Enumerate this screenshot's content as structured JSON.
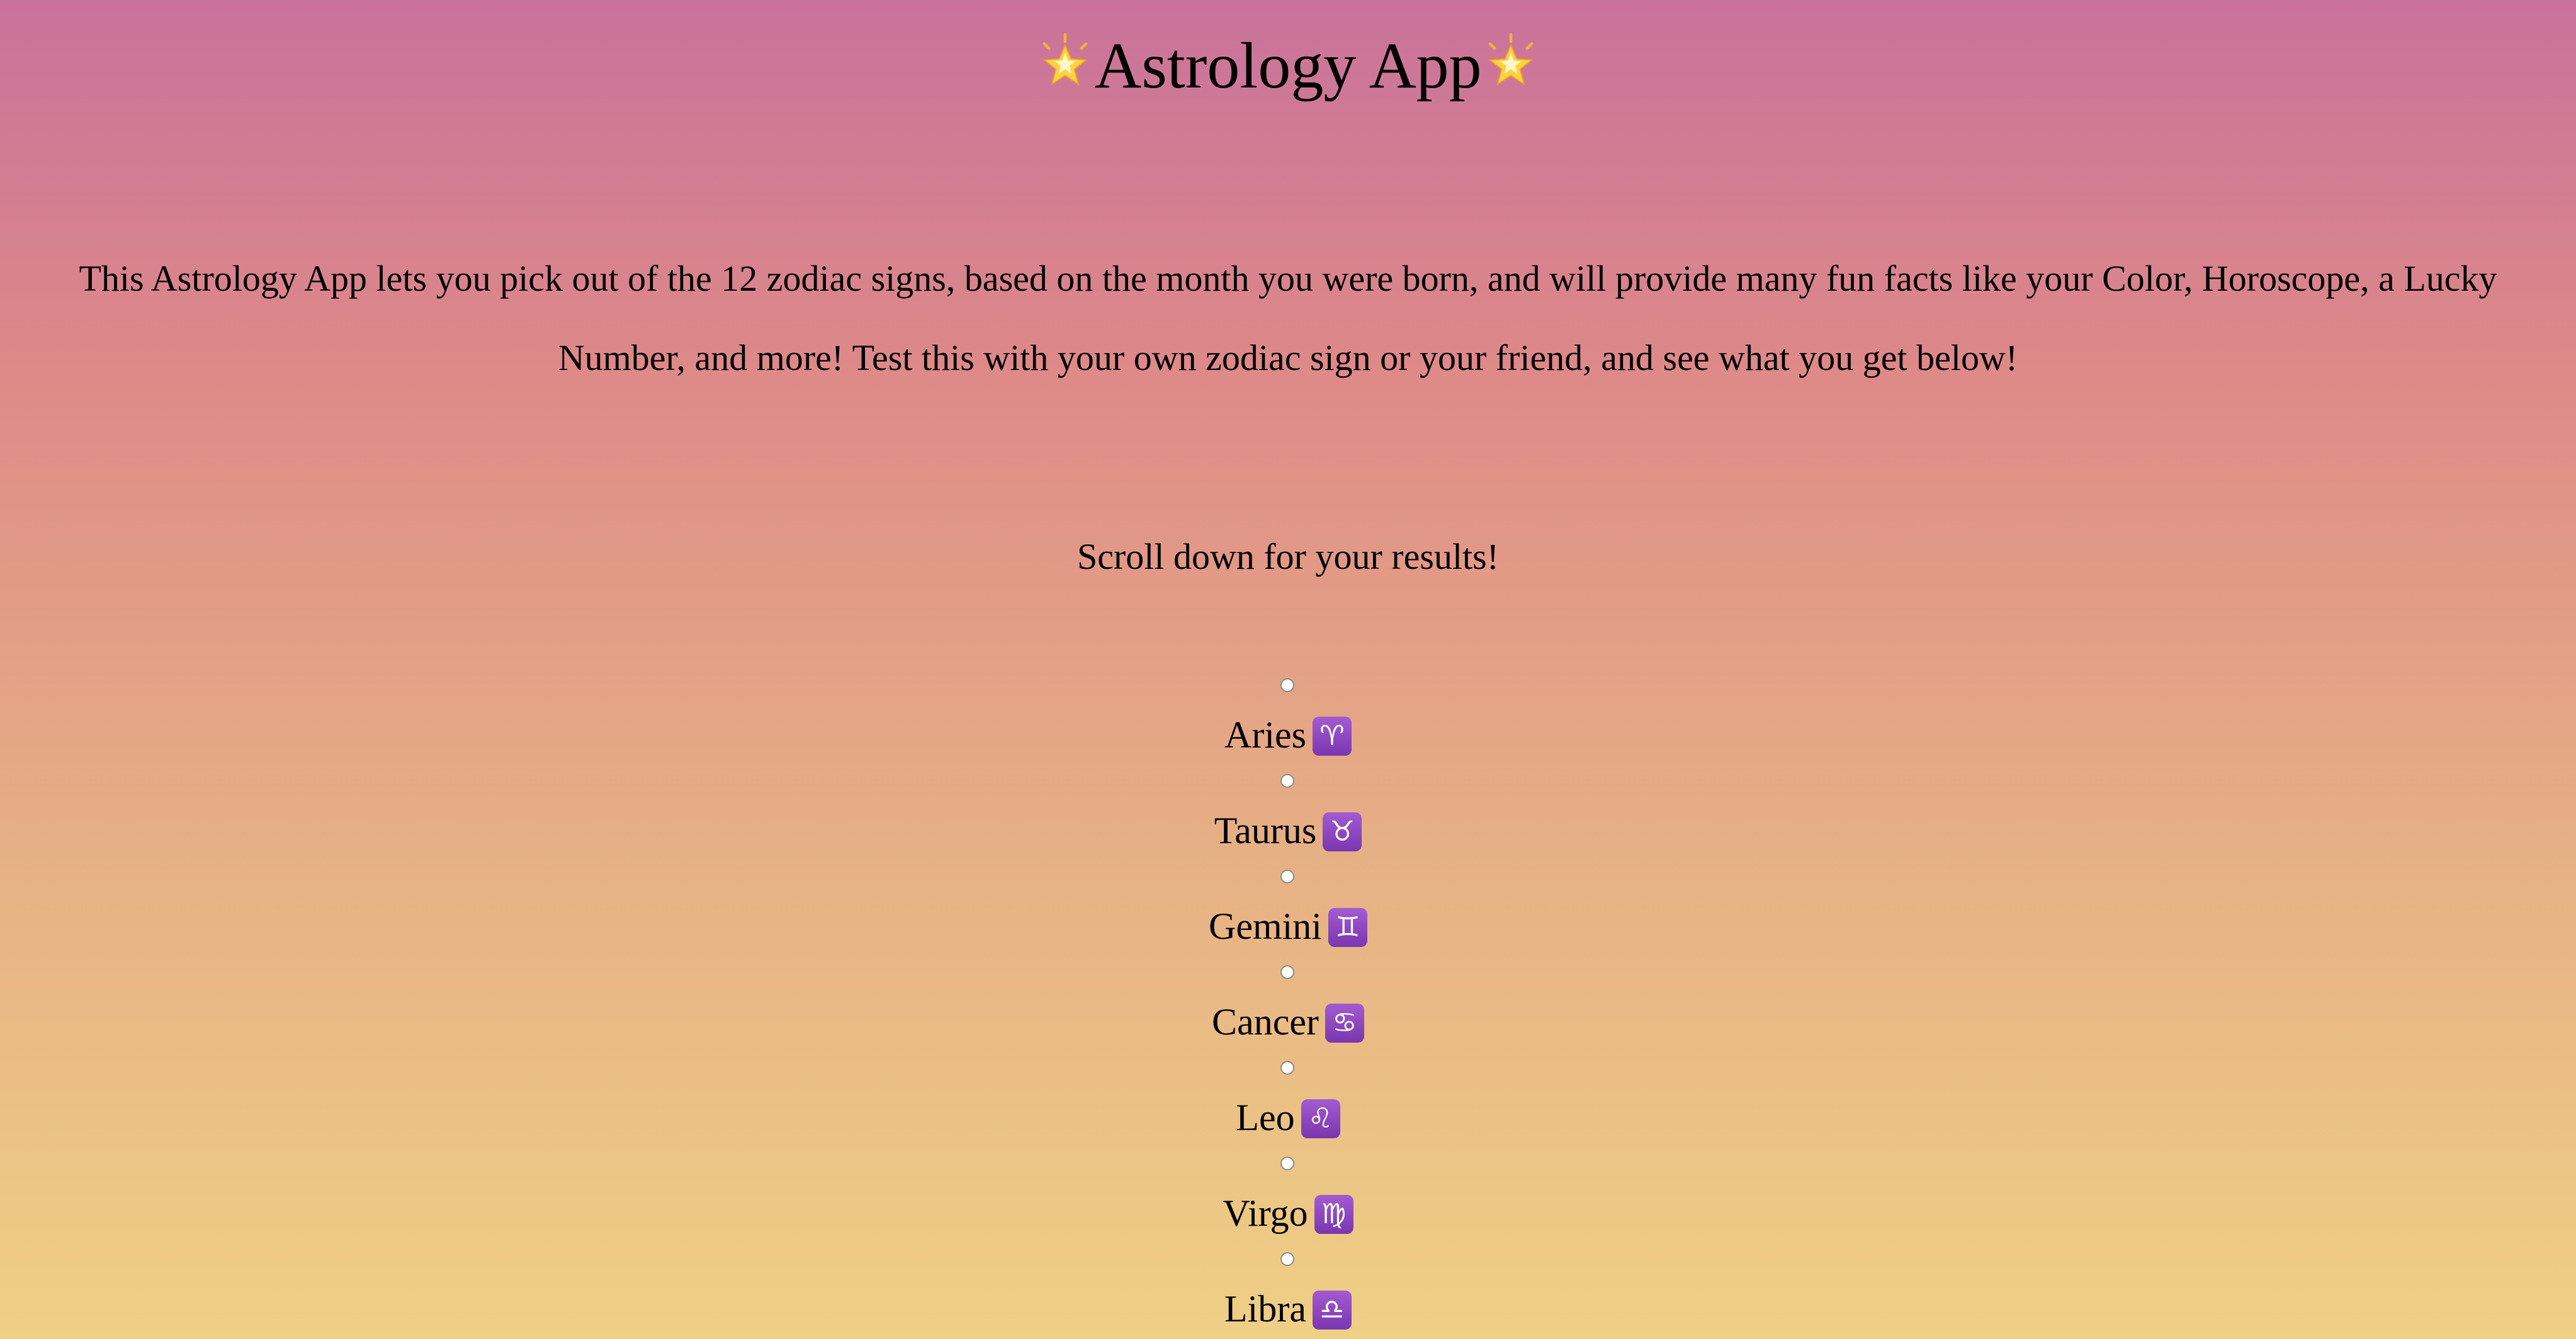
{
  "header": {
    "title": "Astrology App",
    "star_icon": "glowing-star-icon"
  },
  "intro": {
    "line1": "This Astrology App lets you pick out of the 12 zodiac signs, based on the month you were born, and will provide many fun facts like your Color, Horoscope, a Lucky",
    "line2": "Number, and more! Test this with your own zodiac sign or your friend, and see what you get below!"
  },
  "scroll_hint": "Scroll down for your results!",
  "signs": [
    {
      "label": "Aries",
      "glyph": "♈",
      "icon": "aries-icon"
    },
    {
      "label": "Taurus",
      "glyph": "♉",
      "icon": "taurus-icon"
    },
    {
      "label": "Gemini",
      "glyph": "♊",
      "icon": "gemini-icon"
    },
    {
      "label": "Cancer",
      "glyph": "♋",
      "icon": "cancer-icon"
    },
    {
      "label": "Leo",
      "glyph": "♌",
      "icon": "leo-icon"
    },
    {
      "label": "Virgo",
      "glyph": "♍",
      "icon": "virgo-icon"
    },
    {
      "label": "Libra",
      "glyph": "♎",
      "icon": "libra-icon"
    }
  ],
  "colors": {
    "gradient_top": "#c9729c",
    "gradient_bottom": "#efd085",
    "zodiac_badge": "#8e47c2"
  }
}
